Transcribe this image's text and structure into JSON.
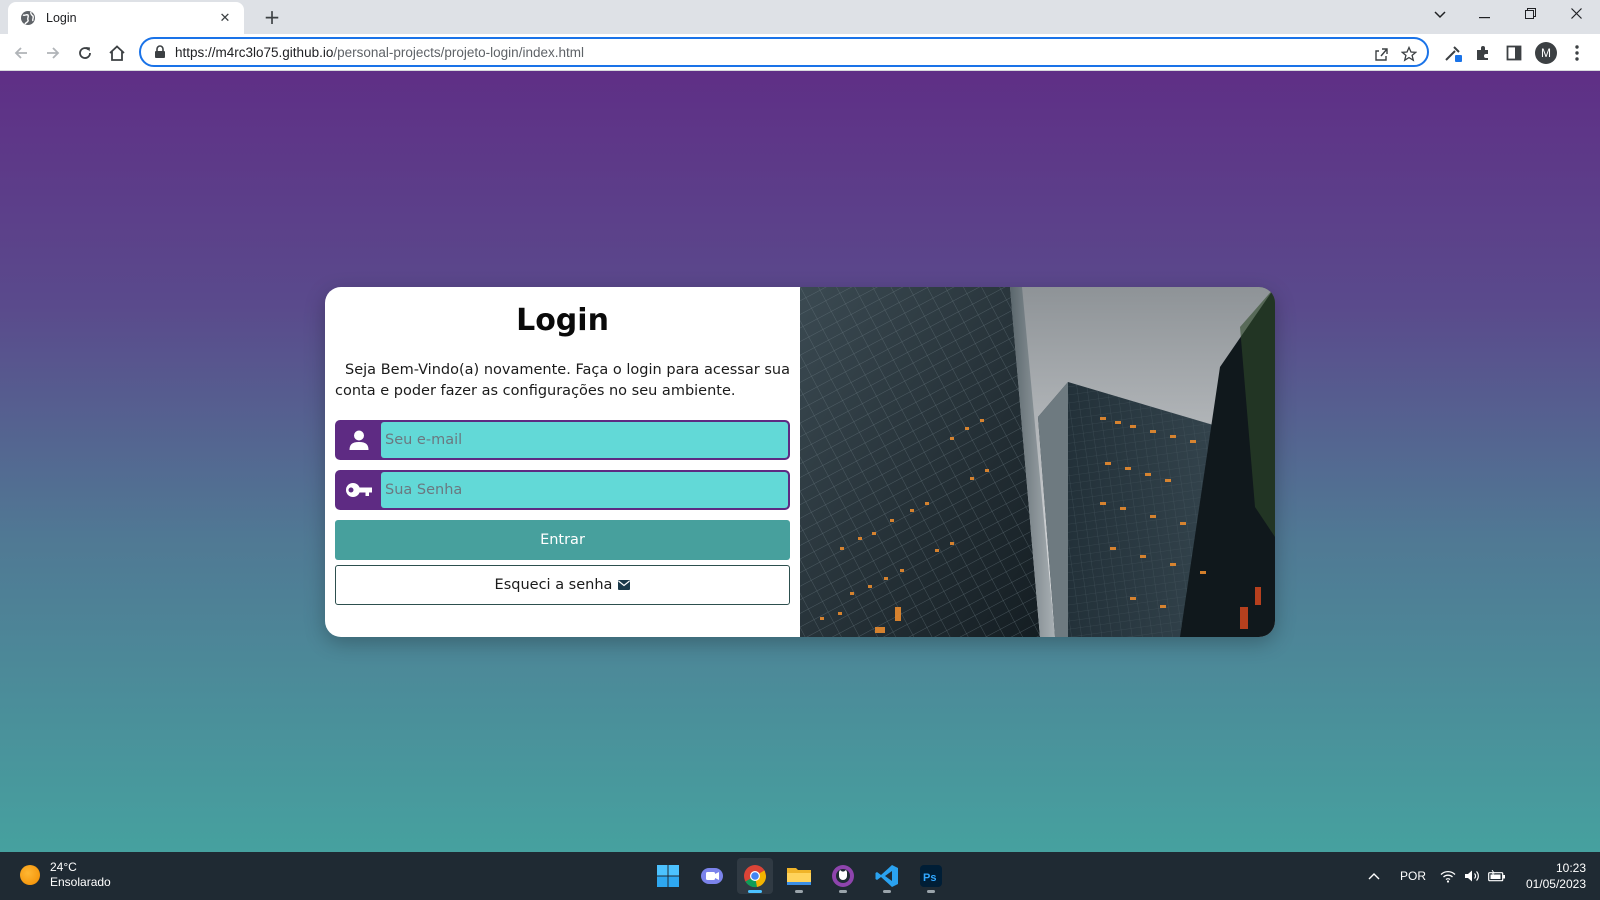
{
  "browser": {
    "tab_title": "Login",
    "tab_close": "✕",
    "new_tab": "+",
    "url_host": "https://m4rc3lo75.github.io",
    "url_path": "/personal-projects/projeto-login/index.html",
    "profile_initial": "M",
    "accent_color": "#1a73e8"
  },
  "page": {
    "title": "Login",
    "description": "Seja Bem-Vindo(a) novamente. Faça o login para acessar sua conta e poder fazer as configurações no seu ambiente.",
    "email_placeholder": "Seu e-mail",
    "password_placeholder": "Sua Senha",
    "enter_label": "Entrar",
    "forgot_label": "Esqueci a senha",
    "colors": {
      "purple": "#5e2b83",
      "input_bg": "#62d9d7",
      "enter_bg": "#47a09d",
      "bg_top": "#5f2f86",
      "bg_bottom": "#46a19f"
    }
  },
  "taskbar": {
    "weather_temp": "24°C",
    "weather_desc": "Ensolarado",
    "language": "POR",
    "time": "10:23",
    "date": "01/05/2023",
    "apps": [
      "windows-start",
      "teams-chat",
      "chrome",
      "file-explorer",
      "github-desktop",
      "vscode",
      "photoshop"
    ]
  }
}
